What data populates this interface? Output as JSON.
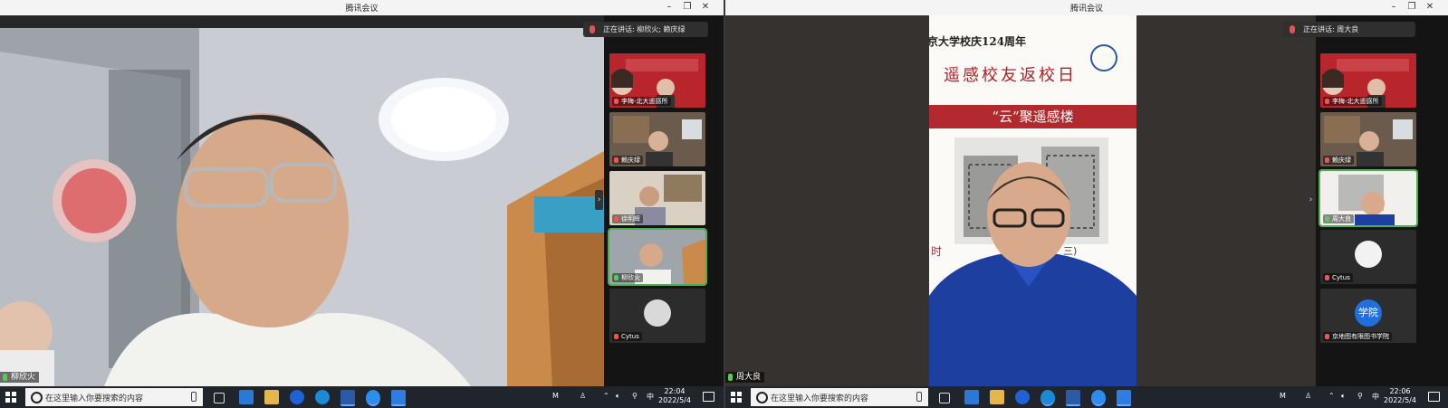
{
  "left": {
    "window_title": "腾讯会议",
    "speaking_label": "正在讲话: 柳欣火; 赖庆绿",
    "main_speaker": "柳欣火",
    "participants": [
      {
        "name": "李梅-北大遥感所"
      },
      {
        "name": "赖庆绿"
      },
      {
        "name": "徐明辉"
      },
      {
        "name": "柳欣火"
      },
      {
        "name": "Cytus"
      }
    ],
    "taskbar": {
      "search_placeholder": "在这里输入你要搜索的内容",
      "tray_m": "M",
      "ime": "中",
      "time": "22:04",
      "date": "2022/5/4"
    }
  },
  "right": {
    "window_title": "腾讯会议",
    "speaking_label": "正在讲话: 周大良",
    "main_speaker": "周大良",
    "slide": {
      "line1": "京大学校庆124周年",
      "line2": "遥感校友返校日",
      "banner": "“云”聚遥感楼",
      "bottom_left": "时",
      "bottom_right": "三)"
    },
    "participants": [
      {
        "name": "李梅-北大遥感所"
      },
      {
        "name": "赖庆绿"
      },
      {
        "name": "周大良"
      },
      {
        "name": "Cytus"
      },
      {
        "name": "京地图有限图书学院",
        "avatar_text": "学院"
      }
    ],
    "taskbar": {
      "search_placeholder": "在这里输入你要搜索的内容",
      "tray_m": "M",
      "ime": "中",
      "time": "22:06",
      "date": "2022/5/4"
    }
  }
}
